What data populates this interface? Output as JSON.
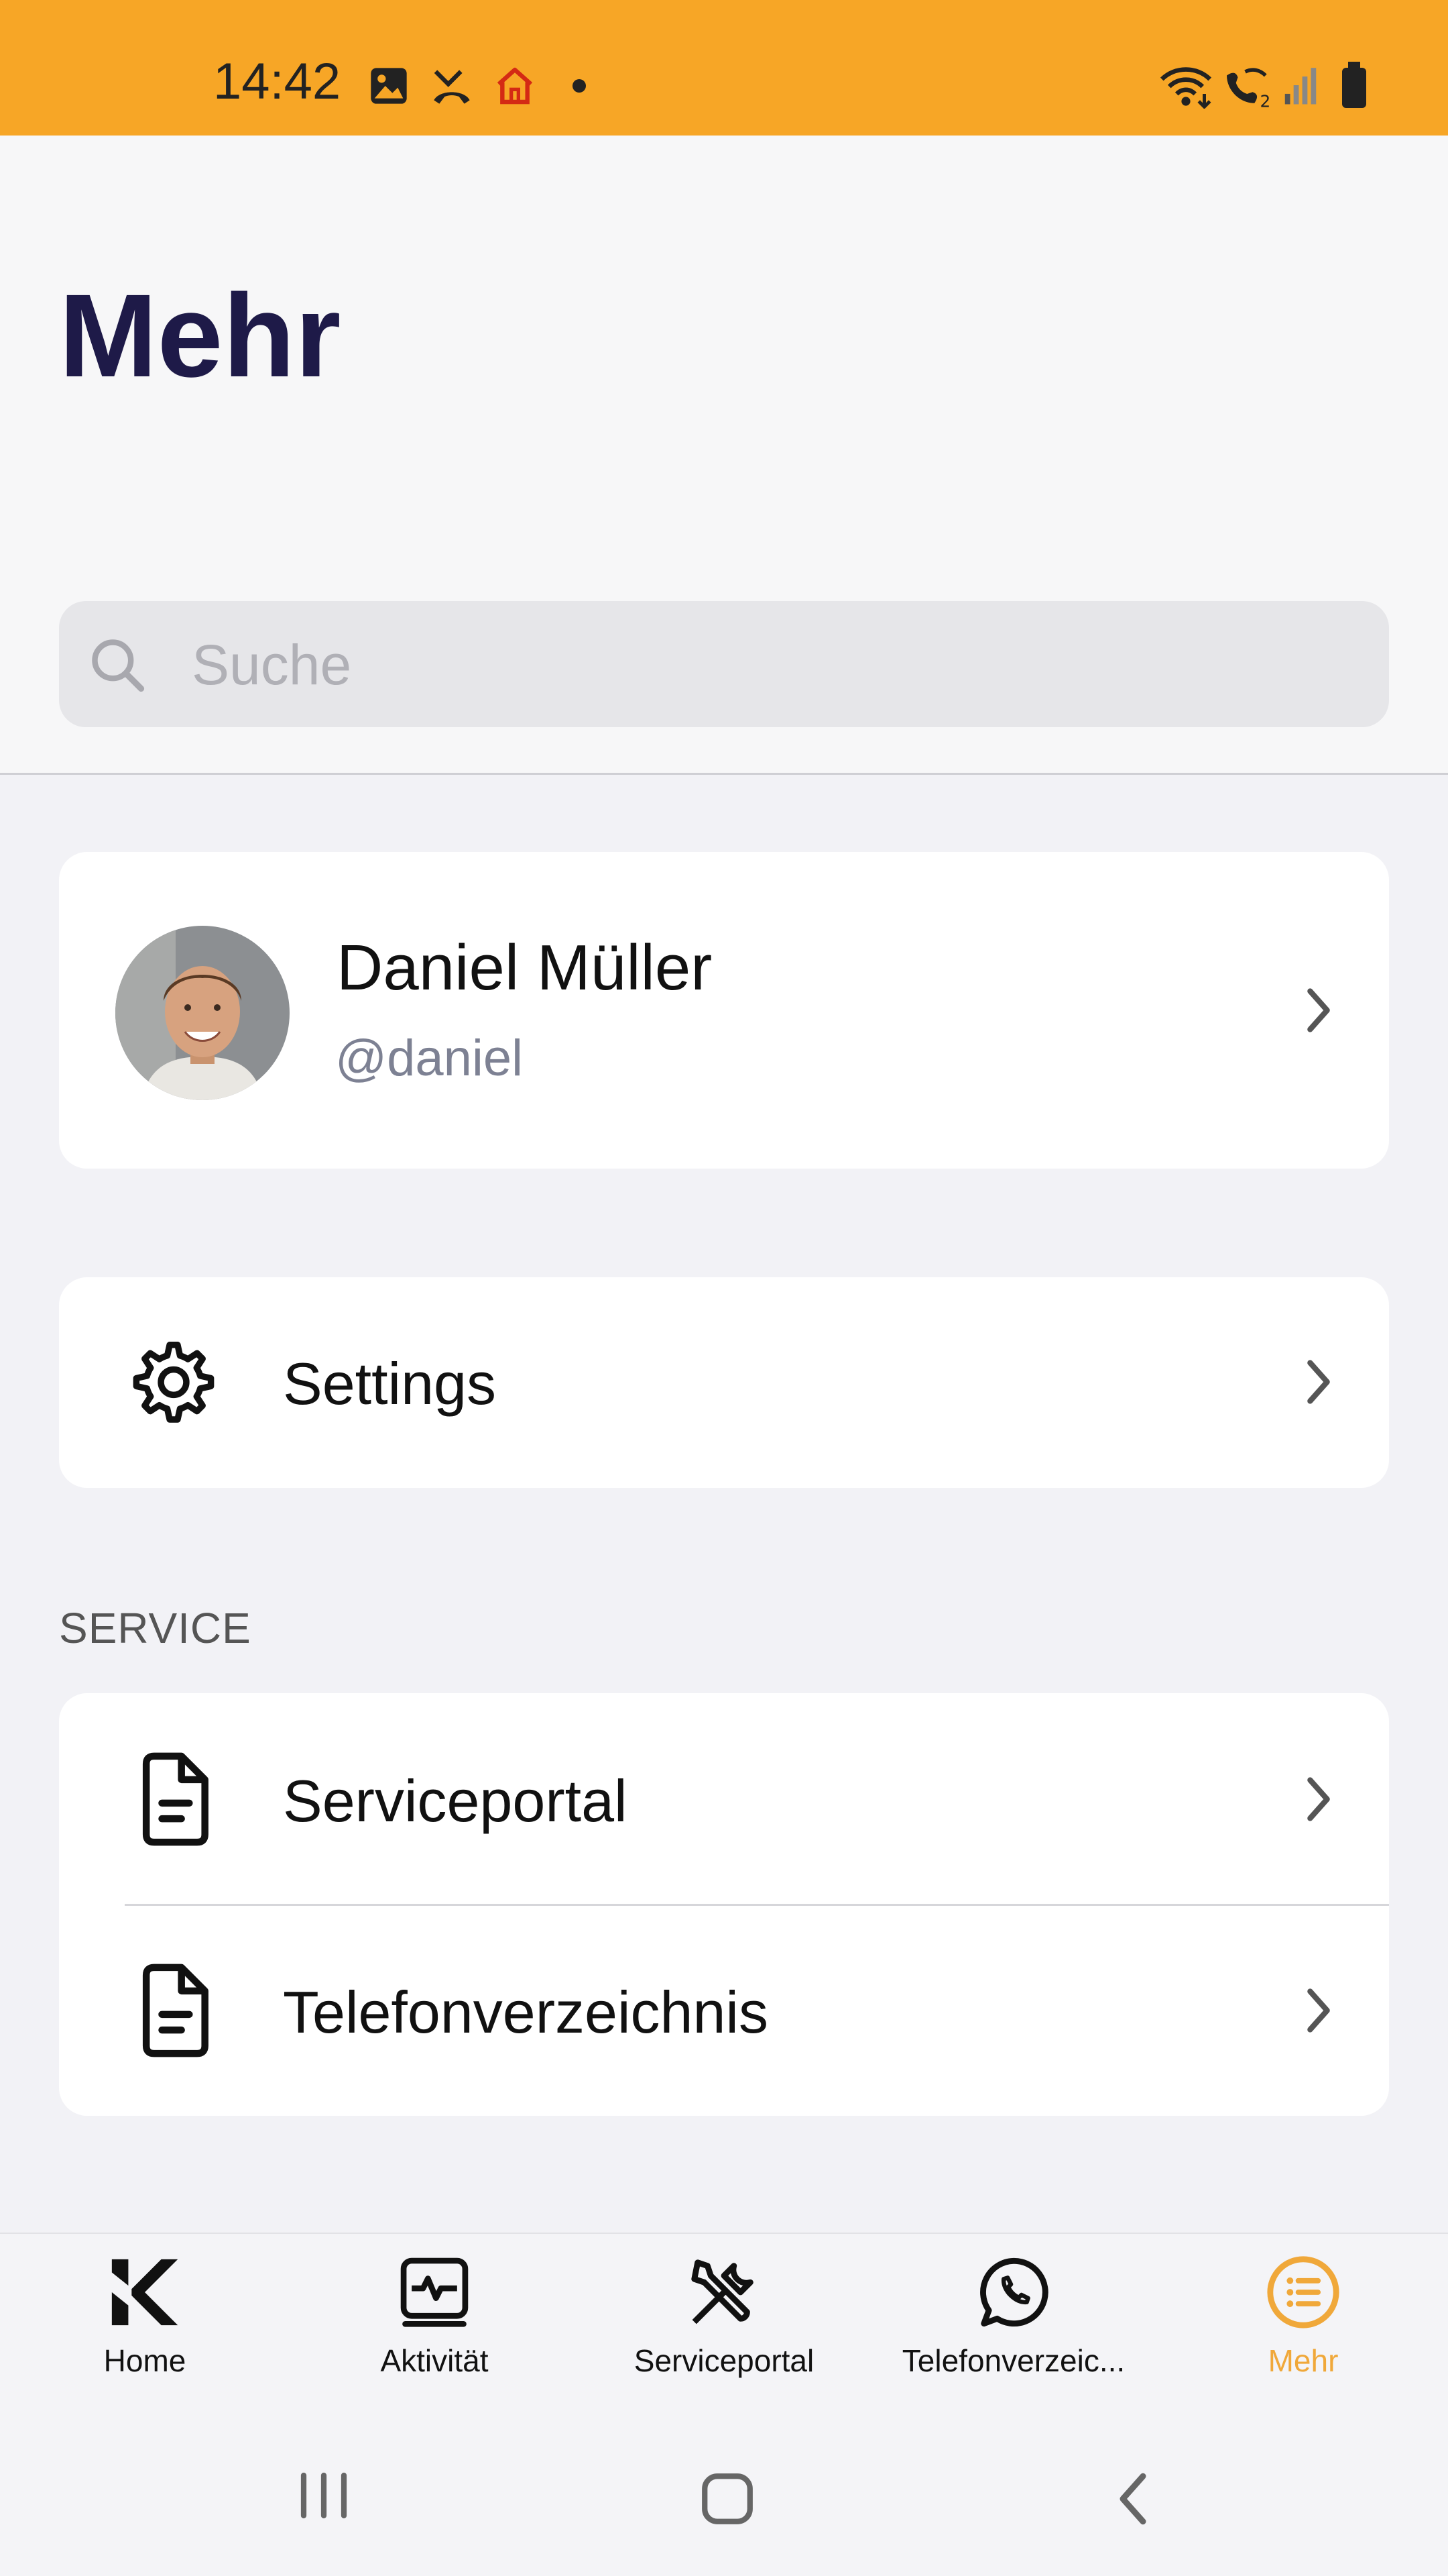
{
  "status_bar": {
    "time": "14:42",
    "left_icons": [
      "image-icon",
      "missed-call-icon",
      "home-icon",
      "dot-icon"
    ],
    "right_icons": [
      "wifi-icon",
      "wifi-calling-icon",
      "signal-icon",
      "battery-icon"
    ],
    "background": "#f7a626"
  },
  "header": {
    "title": "Mehr"
  },
  "search": {
    "placeholder": "Suche"
  },
  "profile": {
    "name": "Daniel Müller",
    "handle": "@daniel"
  },
  "settings": {
    "label": "Settings",
    "icon": "gear-icon"
  },
  "service_section": {
    "title": "SERVICE",
    "items": [
      {
        "label": "Serviceportal",
        "icon": "document-icon"
      },
      {
        "label": "Telefonverzeichnis",
        "icon": "document-icon"
      }
    ]
  },
  "bottom_nav": {
    "items": [
      {
        "label": "Home",
        "icon": "logo-k-icon",
        "active": false
      },
      {
        "label": "Aktivität",
        "icon": "activity-icon",
        "active": false
      },
      {
        "label": "Serviceportal",
        "icon": "tools-icon",
        "active": false
      },
      {
        "label": "Telefonverzeic...",
        "icon": "phone-bubble-icon",
        "active": false
      },
      {
        "label": "Mehr",
        "icon": "menu-list-icon",
        "active": true
      }
    ],
    "active_color": "#f0a83a"
  },
  "system_nav": {
    "buttons": [
      "recent-apps-icon",
      "home-button-icon",
      "back-icon"
    ]
  },
  "colors": {
    "title": "#1e1a48",
    "accent": "#f7a626",
    "background": "#f2f2f6"
  }
}
